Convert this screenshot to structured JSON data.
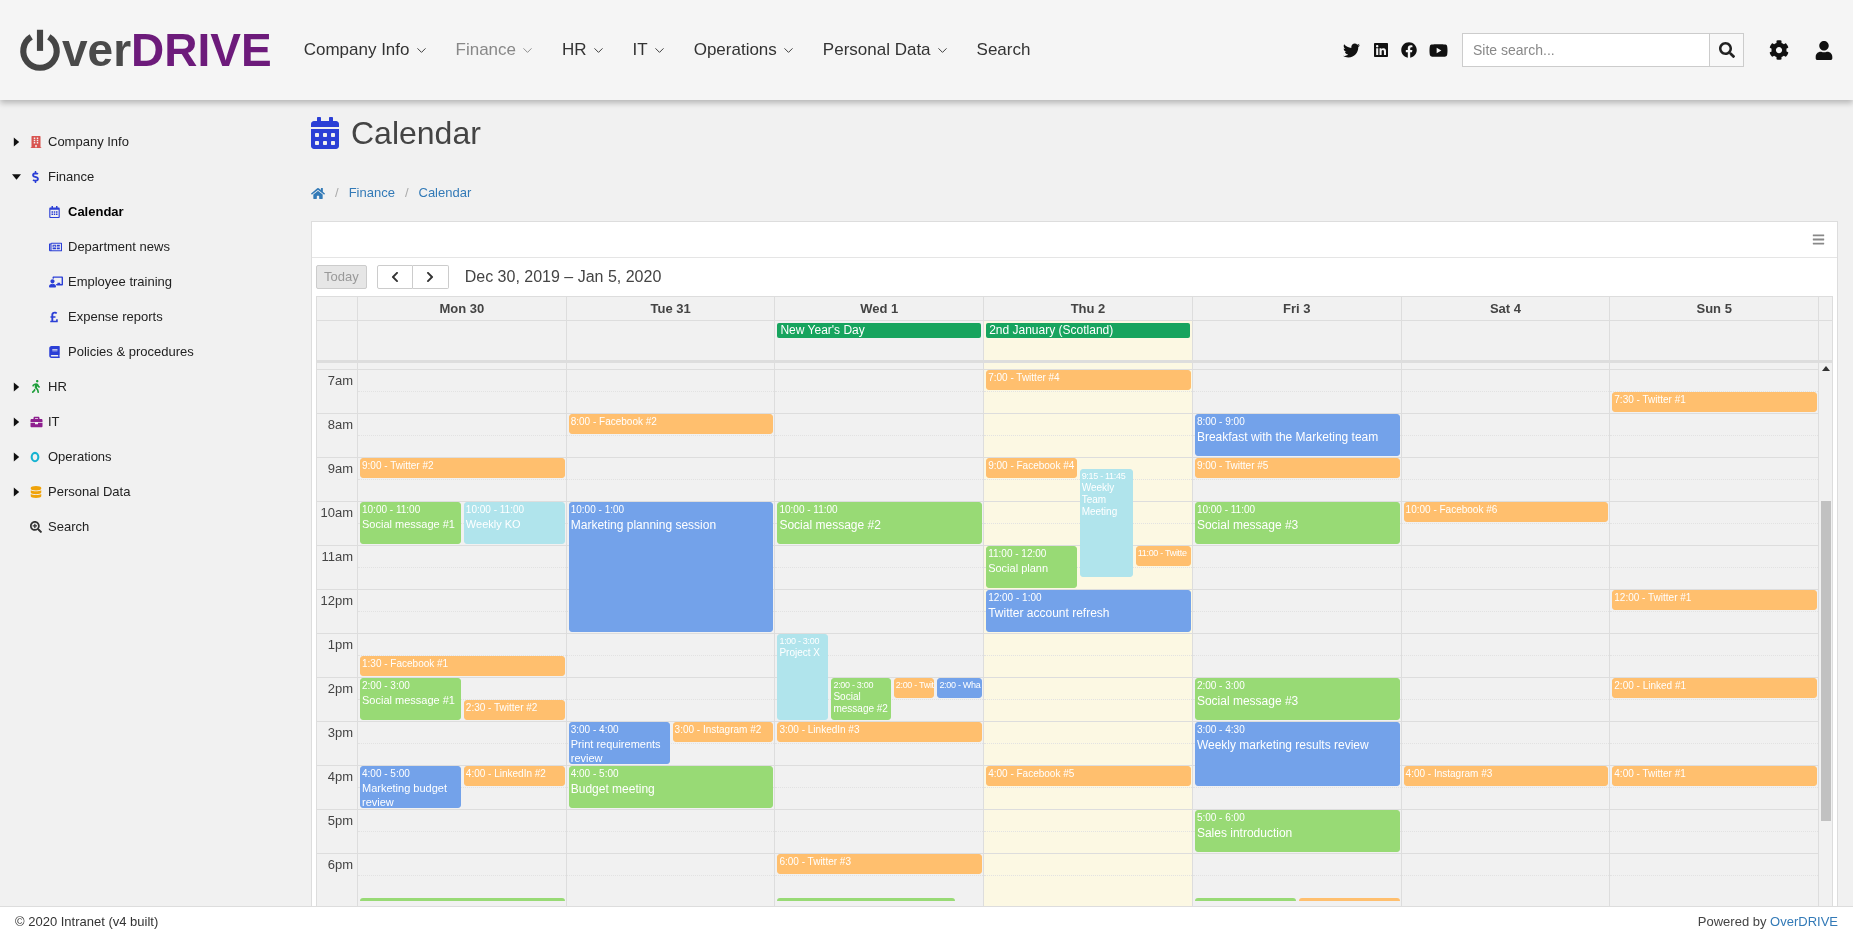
{
  "logo": {
    "light": "ver",
    "bold": "DRIVE"
  },
  "nav": [
    {
      "label": "Company Info",
      "selected": false,
      "dropdown": true
    },
    {
      "label": "Finance",
      "selected": true,
      "dropdown": true
    },
    {
      "label": "HR",
      "selected": false,
      "dropdown": true
    },
    {
      "label": "IT",
      "selected": false,
      "dropdown": true
    },
    {
      "label": "Operations",
      "selected": false,
      "dropdown": true
    },
    {
      "label": "Personal Data",
      "selected": false,
      "dropdown": true
    },
    {
      "label": "Search",
      "selected": false,
      "dropdown": false
    }
  ],
  "search": {
    "placeholder": "Site search..."
  },
  "sidebar": {
    "items": [
      {
        "label": "Company Info",
        "expanded": false
      },
      {
        "label": "Finance",
        "expanded": true,
        "children": [
          {
            "label": "Calendar",
            "selected": true
          },
          {
            "label": "Department news",
            "selected": false
          },
          {
            "label": "Employee training",
            "selected": false
          },
          {
            "label": "Expense reports",
            "selected": false
          },
          {
            "label": "Policies & procedures",
            "selected": false
          }
        ]
      },
      {
        "label": "HR",
        "expanded": false
      },
      {
        "label": "IT",
        "expanded": false
      },
      {
        "label": "Operations",
        "expanded": false
      },
      {
        "label": "Personal Data",
        "expanded": false
      },
      {
        "label": "Search"
      }
    ]
  },
  "page_title": "Calendar",
  "breadcrumb": [
    {
      "separator": "/",
      "label": "Finance"
    },
    {
      "separator": "/",
      "label": "Calendar"
    }
  ],
  "calendar": {
    "today_button": {
      "label": "Today",
      "disabled": true
    },
    "range": "Dec 30, 2019 – Jan 5, 2020",
    "hours": [
      "7am",
      "8am",
      "9am",
      "10am",
      "11am",
      "12pm",
      "1pm",
      "2pm",
      "3pm",
      "4pm",
      "5pm",
      "6pm"
    ],
    "days": [
      {
        "label": "Mon 30",
        "today": false,
        "events": [
          {
            "kind": "short",
            "label": "9:00 - Twitter #2",
            "color": "#ffbf6e"
          },
          {
            "kind": "timed",
            "time": "10:00 - 11:00",
            "title": "Social message #1",
            "color": "#98da75"
          },
          {
            "kind": "timed",
            "time": "10:00 - 11:00",
            "title": "Weekly KO",
            "color": "#b0e4ec"
          },
          {
            "kind": "short",
            "label": "1:30 - Facebook #1",
            "color": "#ffbf6e"
          },
          {
            "kind": "timed",
            "time": "2:00 - 3:00",
            "title": "Social message #1",
            "color": "#98da75"
          },
          {
            "kind": "short",
            "label": "2:30 - Twitter #2",
            "color": "#ffbf6e"
          },
          {
            "kind": "timed",
            "time": "4:00 - 5:00",
            "title": "Marketing budget review",
            "color": "#73a2ea"
          },
          {
            "kind": "short",
            "label": "4:00 - LinkedIn #2",
            "color": "#ffbf6e"
          },
          {
            "kind": "cut",
            "color": "#98da75"
          }
        ]
      },
      {
        "label": "Tue 31",
        "today": false,
        "events": [
          {
            "kind": "short",
            "label": "8:00 - Facebook #2",
            "color": "#ffbf6e"
          },
          {
            "kind": "timed",
            "time": "10:00 - 1:00",
            "title": "Marketing planning session",
            "color": "#73a2ea"
          },
          {
            "kind": "timed",
            "time": "3:00 - 4:00",
            "title": "Print requirements review",
            "color": "#73a2ea"
          },
          {
            "kind": "short",
            "label": "3:00 - Instagram #2",
            "color": "#ffbf6e"
          },
          {
            "kind": "timed",
            "time": "4:00 - 5:00",
            "title": "Budget meeting",
            "color": "#98da75"
          }
        ]
      },
      {
        "label": "Wed 1",
        "today": false,
        "all_day": [
          "New Year's Day"
        ],
        "events": [
          {
            "kind": "timed",
            "time": "10:00 - 11:00",
            "title": "Social message #2",
            "color": "#98da75"
          },
          {
            "kind": "timed",
            "time": "1:00 - 3:00",
            "title": "Project X",
            "color": "#b0e4ec"
          },
          {
            "kind": "timed",
            "time": "2:00 - 3:00",
            "title": "Social message #2",
            "color": "#98da75"
          },
          {
            "kind": "short",
            "label": "2:00 - Twit",
            "color": "#ffbf6e"
          },
          {
            "kind": "short",
            "label": "2:00 - Wha",
            "color": "#73a2ea"
          },
          {
            "kind": "short",
            "label": "3:00 - LinkedIn #3",
            "color": "#ffbf6e"
          },
          {
            "kind": "short",
            "label": "6:00 - Twitter #3",
            "color": "#ffbf6e"
          },
          {
            "kind": "cut",
            "color": "#98da75"
          }
        ]
      },
      {
        "label": "Thu 2",
        "today": true,
        "all_day": [
          "2nd January (Scotland)"
        ],
        "events": [
          {
            "kind": "short",
            "label": "7:00 - Twitter #4",
            "color": "#ffbf6e"
          },
          {
            "kind": "short",
            "label": "9:00 - Facebook #4",
            "color": "#ffbf6e"
          },
          {
            "kind": "timed",
            "time": "11:00 - 12:00",
            "title": "Social plann",
            "color": "#98da75"
          },
          {
            "kind": "timed",
            "time": "9:15 - 11:45",
            "title": "Weekly Team Meeting",
            "color": "#b0e4ec"
          },
          {
            "kind": "short",
            "label": "11:00 - Twitte",
            "color": "#ffbf6e"
          },
          {
            "kind": "timed",
            "time": "12:00 - 1:00",
            "title": "Twitter account refresh",
            "color": "#73a2ea"
          },
          {
            "kind": "short",
            "label": "4:00 - Facebook #5",
            "color": "#ffbf6e"
          }
        ]
      },
      {
        "label": "Fri 3",
        "today": false,
        "events": [
          {
            "kind": "timed",
            "time": "8:00 - 9:00",
            "title": "Breakfast with the Marketing team",
            "color": "#73a2ea"
          },
          {
            "kind": "short",
            "label": "9:00 - Twitter #5",
            "color": "#ffbf6e"
          },
          {
            "kind": "timed",
            "time": "10:00 - 11:00",
            "title": "Social message #3",
            "color": "#98da75"
          },
          {
            "kind": "timed",
            "time": "2:00 - 3:00",
            "title": "Social message #3",
            "color": "#98da75"
          },
          {
            "kind": "timed",
            "time": "3:00 - 4:30",
            "title": "Weekly marketing results review",
            "color": "#73a2ea"
          },
          {
            "kind": "timed",
            "time": "5:00 - 6:00",
            "title": "Sales introduction",
            "color": "#98da75"
          },
          {
            "kind": "cut",
            "color": "#98da75"
          },
          {
            "kind": "cut",
            "color": "#ffbf6e"
          }
        ]
      },
      {
        "label": "Sat 4",
        "today": false,
        "events": [
          {
            "kind": "short",
            "label": "10:00 - Facebook #6",
            "color": "#ffbf6e"
          },
          {
            "kind": "short",
            "label": "4:00 - Instagram #3",
            "color": "#ffbf6e"
          }
        ]
      },
      {
        "label": "Sun 5",
        "today": false,
        "events": [
          {
            "kind": "short",
            "label": "7:30 - Twitter #1",
            "color": "#ffbf6e"
          },
          {
            "kind": "short",
            "label": "12:00 - Twitter #1",
            "color": "#ffbf6e"
          },
          {
            "kind": "short",
            "label": "2:00 - Linked #1",
            "color": "#ffbf6e"
          },
          {
            "kind": "short",
            "label": "4:00 - Twitter #1",
            "color": "#ffbf6e"
          }
        ]
      }
    ]
  },
  "footer": {
    "copyright": "© 2020 Intranet (v4 built)",
    "powered_by": "Powered by",
    "powered_link": "OverDRIVE"
  }
}
